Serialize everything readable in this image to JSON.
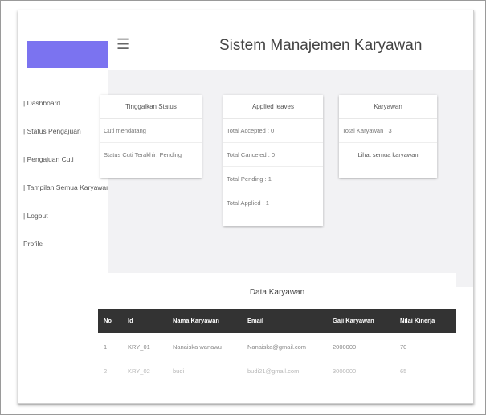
{
  "header": {
    "title": "Sistem Manajemen Karyawan",
    "menu_icon": "☰"
  },
  "sidebar": {
    "items": [
      {
        "label": "| Dashboard"
      },
      {
        "label": "| Status Pengajuan"
      },
      {
        "label": "| Pengajuan Cuti"
      },
      {
        "label": "| Tampilan Semua Karyawan"
      },
      {
        "label": "| Logout"
      },
      {
        "label": "Profile"
      }
    ]
  },
  "cards": {
    "status": {
      "title": "Tinggalkan Status",
      "rows": [
        "Cuti mendatang",
        "Status Cuti Terakhir: Pending"
      ]
    },
    "leaves": {
      "title": "Applied leaves",
      "rows": [
        "Total Accepted : 0",
        "Total Canceled : 0",
        "Total Pending : 1",
        "Total Applied : 1"
      ]
    },
    "karyawan": {
      "title": "Karyawan",
      "rows": [
        "Total Karyawan : 3"
      ],
      "link": "Lihat semua karyawan"
    }
  },
  "table": {
    "title": "Data Karyawan",
    "columns": [
      "No",
      "Id",
      "Nama Karyawan",
      "Email",
      "Gaji Karyawan",
      "Nilai Kinerja"
    ],
    "rows": [
      [
        "1",
        "KRY_01",
        "Nanaiska wanawu",
        "Nanaiska@gmail.com",
        "2000000",
        "70"
      ],
      [
        "2",
        "KRY_02",
        "budi",
        "budi21@gmail.com",
        "3000000",
        "65"
      ]
    ]
  },
  "colors": {
    "accent": "#7b73f0",
    "panel_bg": "#f2f2f4",
    "table_header_bg": "#333333"
  }
}
